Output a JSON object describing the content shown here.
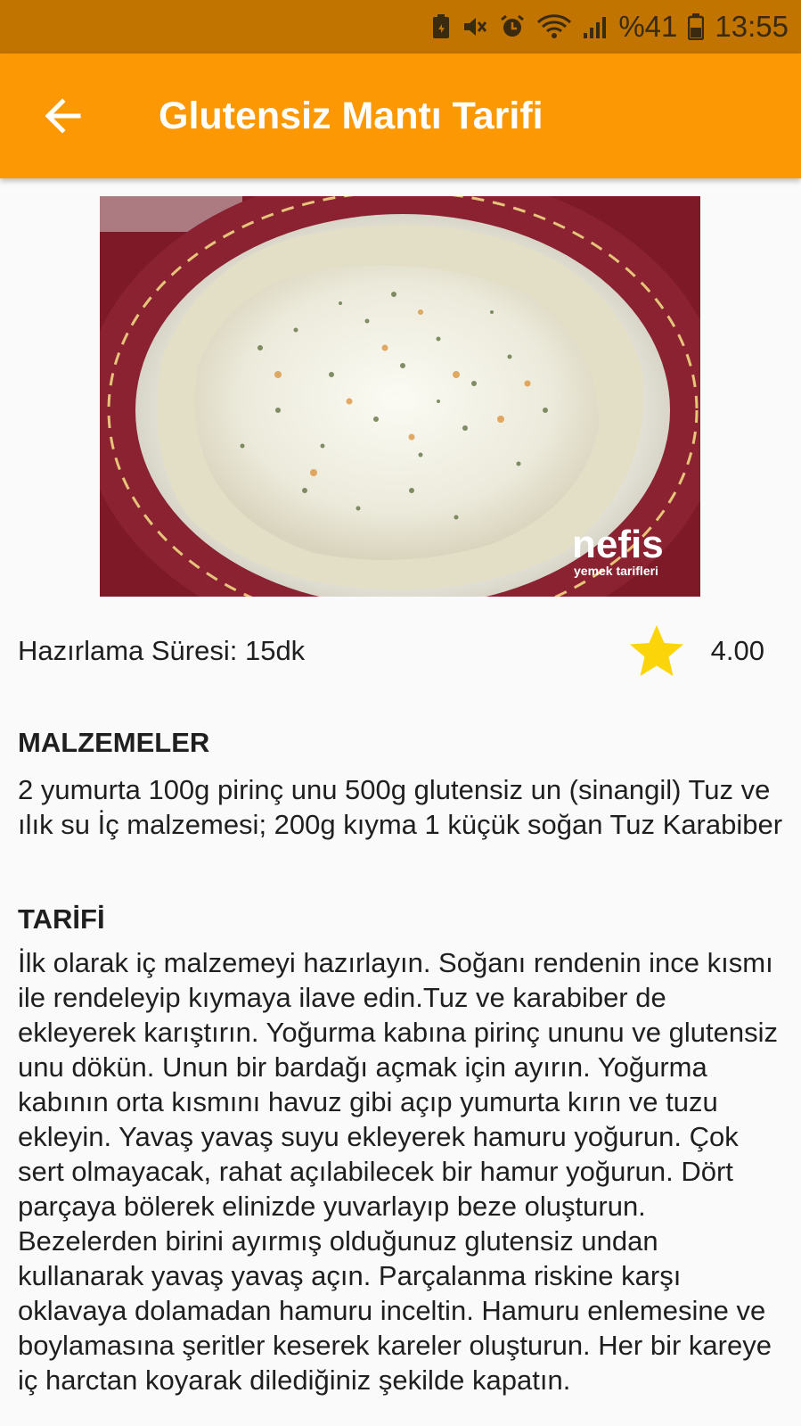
{
  "status_bar": {
    "battery_percent": "%41",
    "time": "13:55"
  },
  "app_bar": {
    "title": "Glutensiz Mantı Tarifi",
    "back_icon": "arrow-left-icon"
  },
  "hero_image": {
    "description_icon": "recipe-photo",
    "watermark_brand": "nefis",
    "watermark_sub": "yemek tarifleri"
  },
  "info": {
    "prep_time": "Hazırlama Süresi: 15dk",
    "rating": "4.00",
    "rating_icon": "star-icon",
    "star_color": "#fbd40a"
  },
  "ingredients": {
    "title": "MALZEMELER",
    "text": "2 yumurta 100g pirinç unu 500g glutensiz un (sinangil) Tuz ve ılık su İç malzemesi; 200g kıyma 1 küçük soğan Tuz Karabiber"
  },
  "recipe": {
    "title": "TARİFİ",
    "text": "İlk olarak iç malzemeyi hazırlayın. Soğanı rendenin ince kısmı ile rendeleyip kıymaya ilave edin.Tuz ve karabiber de ekleyerek karıştırın. Yoğurma kabına pirinç ununu ve glutensiz unu dökün. Unun bir bardağı açmak için ayırın. Yoğurma kabının orta kısmını havuz gibi açıp yumurta kırın ve tuzu ekleyin. Yavaş yavaş suyu ekleyerek hamuru yoğurun. Çok sert olmayacak, rahat açılabilecek bir hamur yoğurun. Dört parçaya bölerek elinizde yuvarlayıp beze oluşturun. Bezelerden birini ayırmış olduğunuz glutensiz undan kullanarak yavaş yavaş açın. Parçalanma riskine karşı oklavaya dolamadan hamuru inceltin. Hamuru enlemesine ve boylamasına şeritler keserek kareler oluşturun. Her bir kareye iç harctan koyarak dilediğiniz şekilde kapatın."
  },
  "colors": {
    "status_bar": "#c17400",
    "app_bar": "#fb9803",
    "background": "#fafafa"
  }
}
